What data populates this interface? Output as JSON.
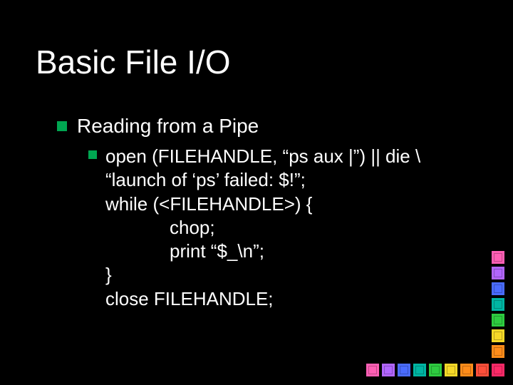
{
  "title": "Basic File I/O",
  "subtitle": "Reading from a Pipe",
  "code": {
    "l1": "open (FILEHANDLE, “ps aux |”) || die \\",
    "l2": "“launch of ‘ps’ failed: $!”;",
    "l3": "while (<FILEHANDLE>) {",
    "l4": "chop;",
    "l5": "print “$_\\n”;",
    "l6": "}",
    "l7": "close FILEHANDLE;"
  },
  "palette": {
    "vertical": [
      "#ff5fb4",
      "#b266ff",
      "#4a6cff",
      "#00b5a3",
      "#2ecc40",
      "#f6d928",
      "#ff8c1a"
    ],
    "horizontal": [
      "#ff5fb4",
      "#b266ff",
      "#4a6cff",
      "#00b5a3",
      "#2ecc40",
      "#f6d928",
      "#ff8c1a",
      "#ff4f3a",
      "#ff2a68"
    ]
  }
}
